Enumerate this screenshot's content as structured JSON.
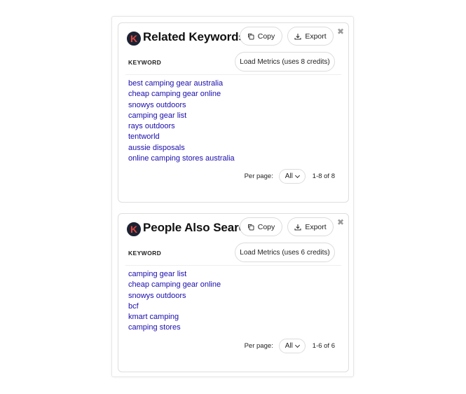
{
  "panels": [
    {
      "logo_letter": "K",
      "title": "Related Keywords",
      "copy_label": "Copy",
      "export_label": "Export",
      "close_glyph": "✖",
      "column_header": "KEYWORD",
      "load_metrics_label": "Load Metrics (uses 8 credits)",
      "keywords": [
        "best camping gear australia",
        "cheap camping gear online",
        "snowys outdoors",
        "camping gear list",
        "rays outdoors",
        "tentworld",
        "aussie disposals",
        "online camping stores australia"
      ],
      "per_page_label": "Per page:",
      "per_page_value": "All",
      "range_text": "1-8 of 8"
    },
    {
      "logo_letter": "K",
      "title": "People Also Search For",
      "copy_label": "Copy",
      "export_label": "Export",
      "close_glyph": "✖",
      "column_header": "KEYWORD",
      "load_metrics_label": "Load Metrics (uses 6 credits)",
      "keywords": [
        "camping gear list",
        "cheap camping gear online",
        "snowys outdoors",
        "bcf",
        "kmart camping",
        "camping stores"
      ],
      "per_page_label": "Per page:",
      "per_page_value": "All",
      "range_text": "1-6 of 6"
    }
  ],
  "colors": {
    "link": "#1a0dab",
    "logo_bg": "#1c2333",
    "logo_letter": "#e0463d",
    "border": "#dedede"
  },
  "icons": {
    "copy": "copy-icon",
    "export": "download-icon",
    "close": "close-icon",
    "dropdown": "chevron-down-icon"
  }
}
